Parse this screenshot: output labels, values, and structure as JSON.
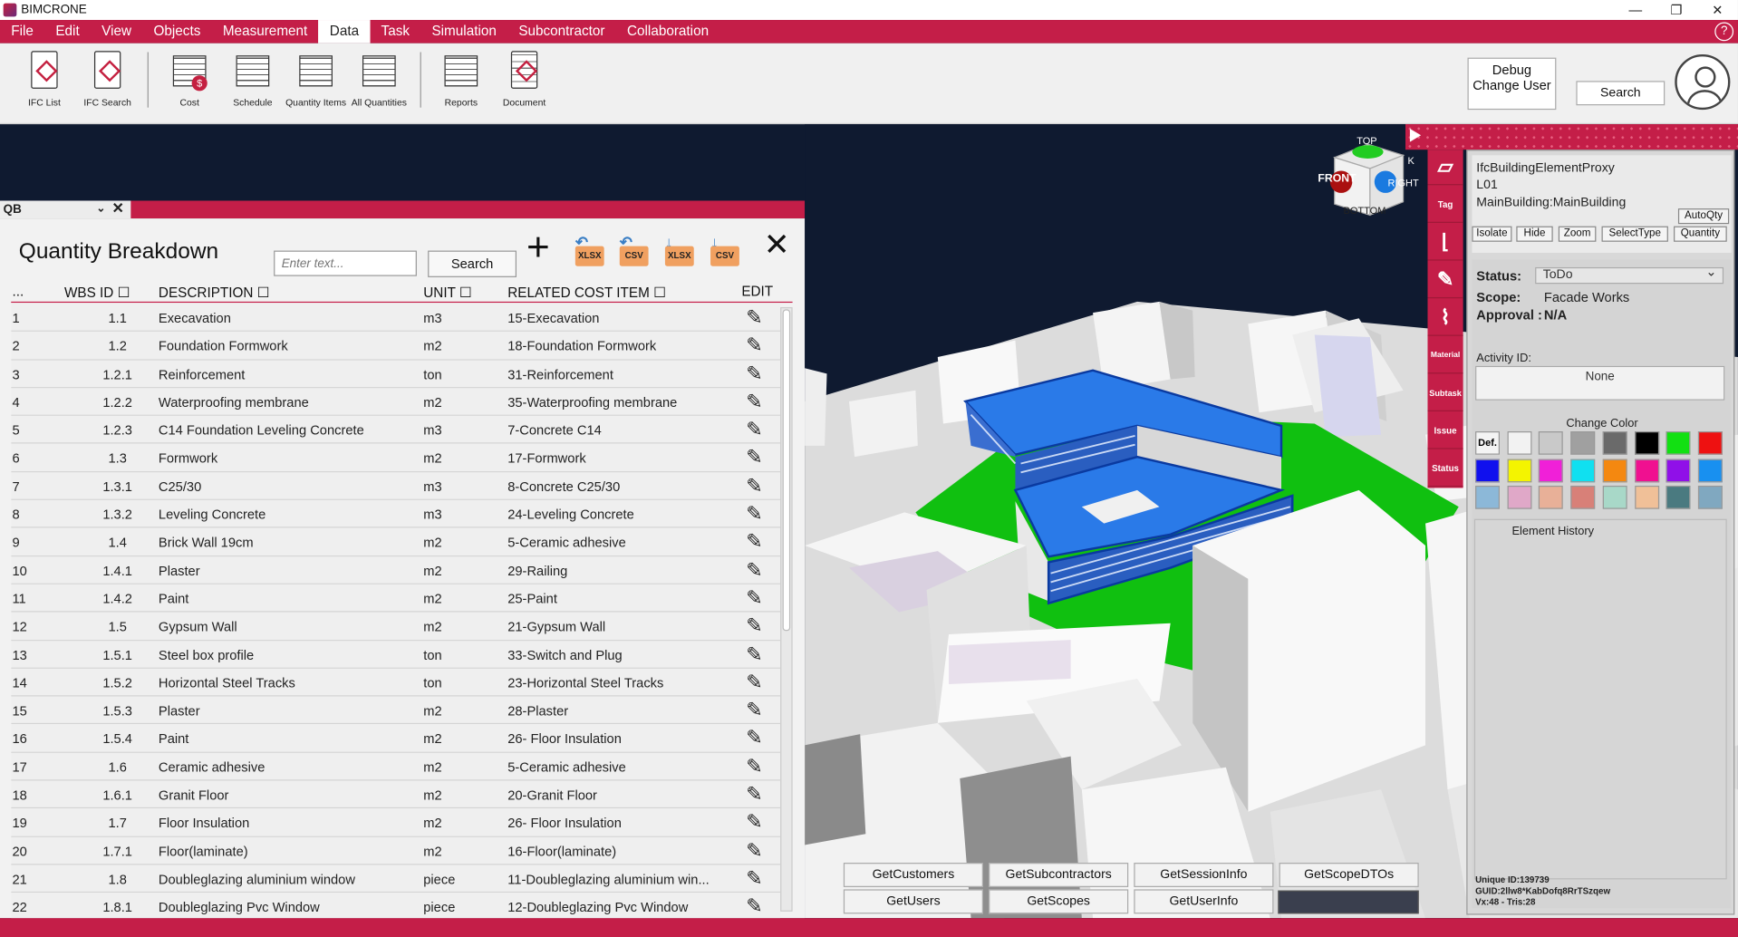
{
  "app": {
    "title": "BIMCRONE"
  },
  "window_controls": [
    "—",
    "❐",
    "✕"
  ],
  "menu": [
    "File",
    "Edit",
    "View",
    "Objects",
    "Measurement",
    "Data",
    "Task",
    "Simulation",
    "Subcontractor",
    "Collaboration"
  ],
  "menu_active": "Data",
  "help_label": "?",
  "ribbon": {
    "buttons": [
      "IFC List",
      "IFC Search",
      "Cost",
      "Schedule",
      "Quantity Items",
      "All Quantities",
      "Reports",
      "Document"
    ],
    "debug_label": "Debug Change User",
    "search_label": "Search"
  },
  "qb": {
    "tab_label": "QB",
    "title": "Quantity Breakdown",
    "search_placeholder": "Enter text...",
    "search_button": "Search",
    "export_buttons": [
      "XLSX",
      "CSV",
      "XLSX",
      "CSV"
    ],
    "columns": [
      "...",
      "WBS ID",
      "DESCRIPTION",
      "UNIT",
      "RELATED COST ITEM",
      "EDIT"
    ],
    "rows": [
      [
        "1",
        "1.1",
        "Execavation",
        "m3",
        "15-Execavation"
      ],
      [
        "2",
        "1.2",
        "Foundation Formwork",
        "m2",
        "18-Foundation Formwork"
      ],
      [
        "3",
        "1.2.1",
        "Reinforcement",
        "ton",
        "31-Reinforcement"
      ],
      [
        "4",
        "1.2.2",
        "Waterproofing membrane",
        "m2",
        "35-Waterproofing membrane"
      ],
      [
        "5",
        "1.2.3",
        "C14 Foundation Leveling Concrete",
        "m3",
        "7-Concrete C14"
      ],
      [
        "6",
        "1.3",
        "Formwork",
        "m2",
        "17-Formwork"
      ],
      [
        "7",
        "1.3.1",
        "C25/30",
        "m3",
        "8-Concrete C25/30"
      ],
      [
        "8",
        "1.3.2",
        "Leveling Concrete",
        "m3",
        "24-Leveling Concrete"
      ],
      [
        "9",
        "1.4",
        "Brick Wall 19cm",
        "m2",
        "5-Ceramic adhesive"
      ],
      [
        "10",
        "1.4.1",
        "Plaster",
        "m2",
        "29-Railing"
      ],
      [
        "11",
        "1.4.2",
        "Paint",
        "m2",
        "25-Paint"
      ],
      [
        "12",
        "1.5",
        "Gypsum Wall",
        "m2",
        "21-Gypsum Wall"
      ],
      [
        "13",
        "1.5.1",
        "Steel box profile",
        "ton",
        "33-Switch and Plug"
      ],
      [
        "14",
        "1.5.2",
        "Horizontal Steel Tracks",
        "ton",
        "23-Horizontal Steel Tracks"
      ],
      [
        "15",
        "1.5.3",
        "Plaster",
        "m2",
        "28-Plaster"
      ],
      [
        "16",
        "1.5.4",
        "Paint",
        "m2",
        "26- Floor Insulation"
      ],
      [
        "17",
        "1.6",
        "Ceramic adhesive",
        "m2",
        "5-Ceramic adhesive"
      ],
      [
        "18",
        "1.6.1",
        "Granit Floor",
        "m2",
        "20-Granit Floor"
      ],
      [
        "19",
        "1.7",
        " Floor Insulation",
        "m2",
        "26- Floor Insulation"
      ],
      [
        "20",
        "1.7.1",
        "Floor(laminate)",
        "m2",
        "16-Floor(laminate)"
      ],
      [
        "21",
        "1.8",
        "Doubleglazing aluminium window",
        "piece",
        "11-Doubleglazing aluminium win..."
      ],
      [
        "22",
        "1.8.1",
        "Doubleglazing Pvc Window",
        "piece",
        "12-Doubleglazing Pvc Window"
      ]
    ]
  },
  "viewcube": {
    "top": "TOP",
    "front": "FRONT",
    "right": "RIGHT",
    "bottom": "BOTTOM",
    "back": "K"
  },
  "api_buttons": [
    "GetCustomers",
    "GetSubcontractors",
    "GetSessionInfo",
    "GetScopeDTOs",
    "GetUsers",
    "GetScopes",
    "GetUserInfo"
  ],
  "side_tools": [
    "Tag",
    "Material",
    "Subtask",
    "Issue",
    "Status"
  ],
  "props": {
    "type": "IfcBuildingElementProxy",
    "level": "L01",
    "name": "MainBuilding:MainBuilding",
    "autoqty": "AutoQty",
    "actions": [
      "Isolate",
      "Hide",
      "Zoom",
      "SelectType",
      "Quantity"
    ],
    "status_label": "Status:",
    "status_value": "ToDo",
    "scope_label": "Scope:",
    "scope_value": "Facade Works",
    "approval_label": "Approval :",
    "approval_value": "N/A",
    "activity_label": "Activity ID:",
    "activity_value": "None",
    "change_color": "Change Color",
    "default_color": "Def.",
    "element_history": "Element History",
    "unique_id": "Unique ID:139739",
    "guid": "GUID:2llw8*KabDofq8RrTSzqew",
    "vx": "Vx:48 - Tris:28"
  },
  "colors": {
    "accent": "#c41e48",
    "swatches": [
      "#f2f2f2",
      "#c9c9c9",
      "#a0a0a0",
      "#6a6a6a",
      "#000000",
      "#12e012",
      "#ee1111",
      "#1010ee",
      "#f4f400",
      "#f020d8",
      "#10e0f0",
      "#f48810",
      "#f01090",
      "#9010e8",
      "#1890f0",
      "#8cb8d8",
      "#e0a8c8",
      "#e8b098",
      "#d88078",
      "#a8d8c8",
      "#f0c098",
      "#4a7a80",
      "#80a8c0"
    ]
  }
}
